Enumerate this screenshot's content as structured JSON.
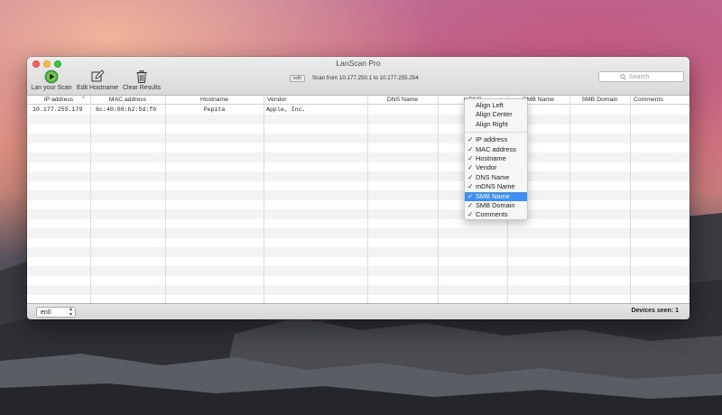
{
  "window": {
    "title": "LanScan Pro"
  },
  "toolbar": {
    "scan_label": "Lan your Scan",
    "edit_hostname_label": "Edit Hostname",
    "clear_results_label": "Clear Results",
    "edit_badge": "edit",
    "scan_range": "Scan from 10.177.250.1 to 10.177.255.254",
    "search_placeholder": "Search",
    "icons": {
      "scan": "play-circle-icon",
      "edit_hostname": "pencil-square-icon",
      "clear_results": "trash-icon",
      "search": "magnifier-icon"
    },
    "colors": {
      "scan_button": "#3fb04a"
    }
  },
  "table": {
    "columns": [
      "IP address",
      "MAC address",
      "Hostname",
      "Vendor",
      "DNS Name",
      "mDNS Name",
      "SMB Name",
      "SMB Domain",
      "Comments"
    ],
    "columns_visible": [
      "IP address",
      "MAC address",
      "Hostname",
      "Vendor",
      "DNS Name",
      "mDNS",
      "SMB Name",
      "SMB Domain",
      "Comments"
    ],
    "sort_indicator": "^",
    "rows": [
      [
        "10.177.255.179",
        "6c:40:08:b2:5d:f0",
        "Pepita",
        "Apple, Inc.",
        "",
        "",
        "",
        "",
        ""
      ]
    ]
  },
  "context_menu": {
    "alignment": [
      "Align Left",
      "Align Center",
      "Align Right"
    ],
    "columns": [
      {
        "label": "IP address",
        "checked": true
      },
      {
        "label": "MAC address",
        "checked": true
      },
      {
        "label": "Hostname",
        "checked": true
      },
      {
        "label": "Vendor",
        "checked": true
      },
      {
        "label": "DNS Name",
        "checked": true
      },
      {
        "label": "mDNS Name",
        "checked": true
      },
      {
        "label": "SMB Name",
        "checked": true,
        "highlighted": true
      },
      {
        "label": "SMB Domain",
        "checked": true
      },
      {
        "label": "Comments",
        "checked": true
      }
    ],
    "checkmark": "✓"
  },
  "footer": {
    "interface": "en0",
    "devices_seen": "Devices seen: 1"
  }
}
